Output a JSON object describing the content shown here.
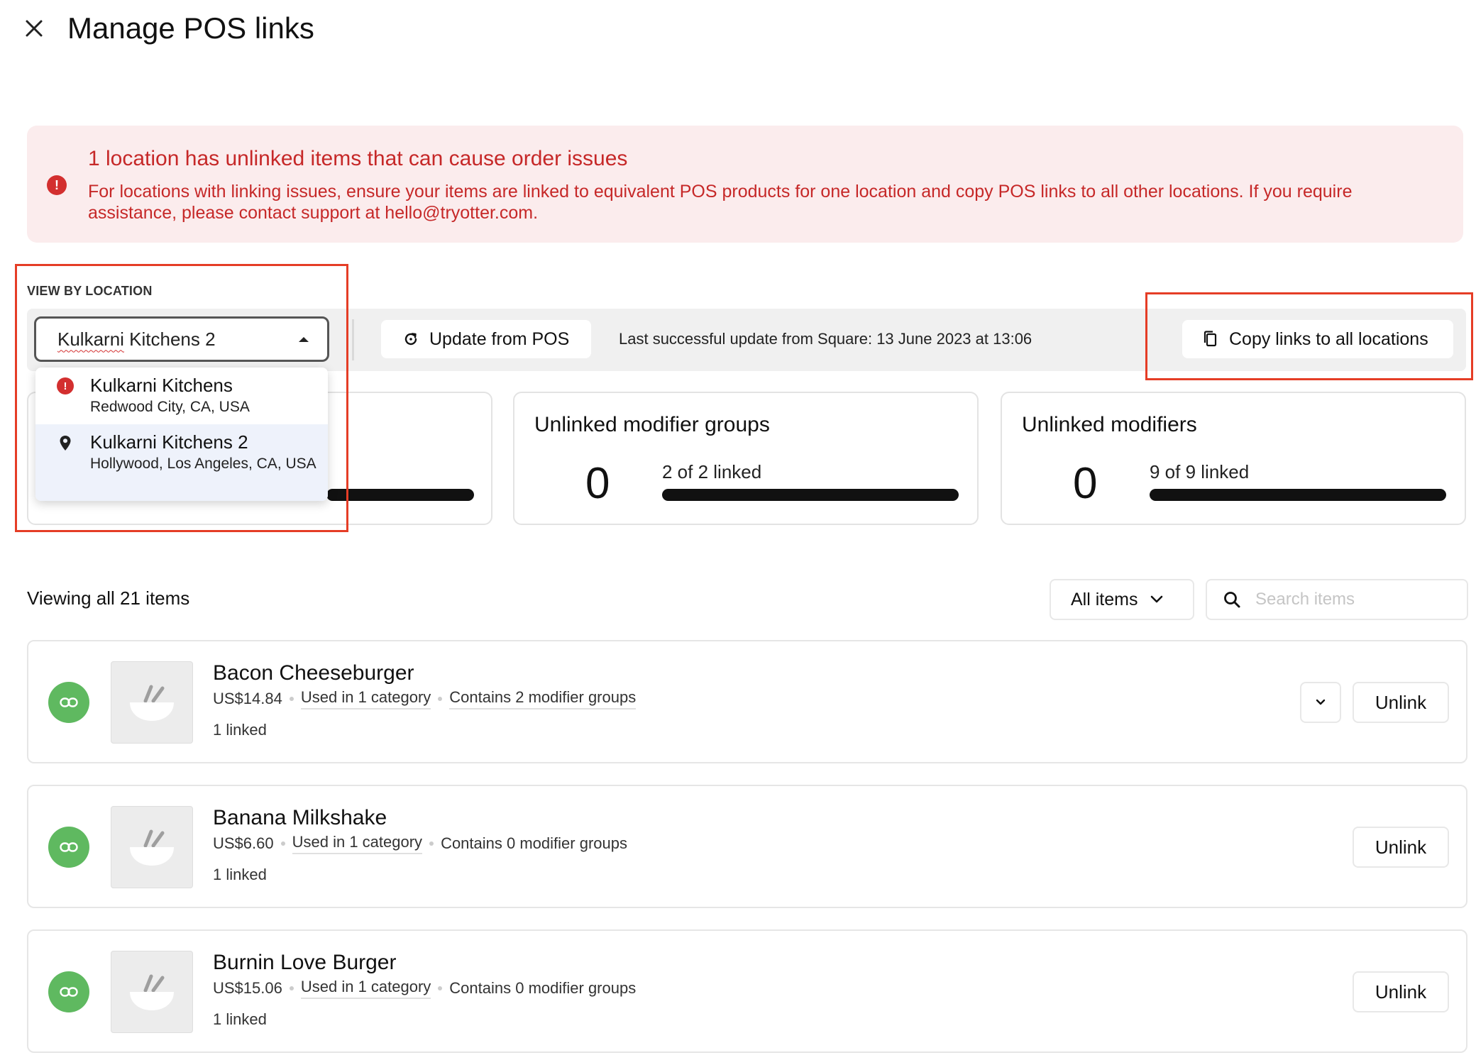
{
  "header": {
    "title": "Manage POS links"
  },
  "alert": {
    "title": "1 location has unlinked items that can cause order issues",
    "body": "For locations with linking issues, ensure your items are linked to equivalent POS products for one location and copy POS links to all other locations. If you require assistance, please contact support at hello@tryotter.com."
  },
  "location": {
    "label": "VIEW BY LOCATION",
    "selected_first": "Kulkarni",
    "selected_rest": " Kitchens 2",
    "options": [
      {
        "name": "Kulkarni Kitchens",
        "address": "Redwood City, CA, USA",
        "icon": "error-icon"
      },
      {
        "name": "Kulkarni Kitchens 2",
        "address": "Hollywood, Los Angeles, CA, USA",
        "icon": "location-pin-icon"
      }
    ]
  },
  "toolbar": {
    "update_label": "Update from POS",
    "last_update": "Last successful update from Square: 13 June 2023 at 13:06",
    "copy_label": "Copy links to all locations"
  },
  "stats": [
    {
      "title": "Unlinked modifier groups",
      "count": "0",
      "linked": "2 of 2 linked"
    },
    {
      "title": "Unlinked modifiers",
      "count": "0",
      "linked": "9 of 9 linked"
    }
  ],
  "list": {
    "viewing": "Viewing all 21 items",
    "filter_label": "All items",
    "search_placeholder": "Search items",
    "unlink_label": "Unlink",
    "items": [
      {
        "name": "Bacon Cheeseburger",
        "price": "US$14.84",
        "category": "Used in 1 category",
        "modifiers": "Contains 2 modifier groups",
        "linked": "1 linked"
      },
      {
        "name": "Banana Milkshake",
        "price": "US$6.60",
        "category": "Used in 1 category",
        "modifiers": "Contains 0 modifier groups",
        "linked": "1 linked"
      },
      {
        "name": "Burnin Love Burger",
        "price": "US$15.06",
        "category": "Used in 1 category",
        "modifiers": "Contains 0 modifier groups",
        "linked": "1 linked"
      }
    ]
  },
  "colors": {
    "error": "#c62828",
    "link_green": "#5fb960",
    "highlight": "#e53d26"
  }
}
